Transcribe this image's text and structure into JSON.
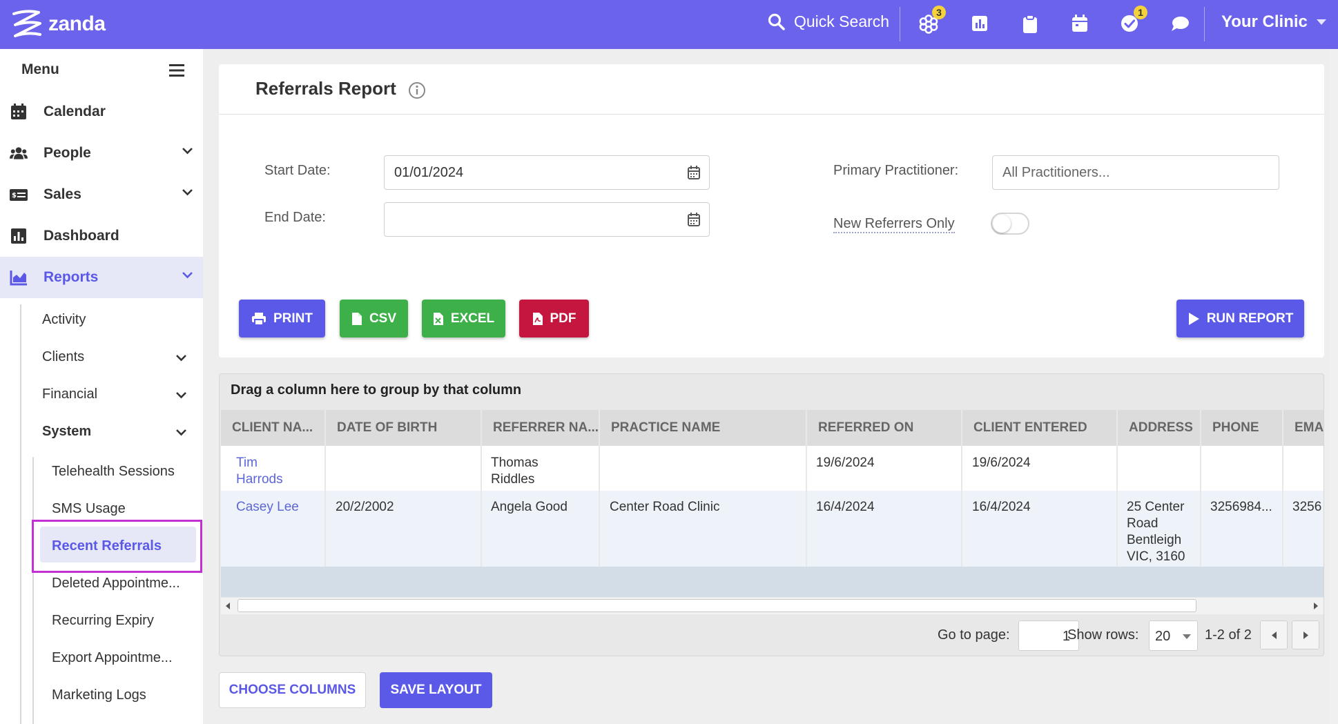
{
  "topbar": {
    "brand": "zanda",
    "quick_search": "Quick Search",
    "apps_badge": "3",
    "tasks_badge": "1",
    "clinic": "Your Clinic",
    "accent": "#6c63ec"
  },
  "sidebar": {
    "menu_label": "Menu",
    "items": [
      {
        "label": "Calendar",
        "icon": "calendar-icon"
      },
      {
        "label": "People",
        "icon": "people-icon"
      },
      {
        "label": "Sales",
        "icon": "sales-icon"
      },
      {
        "label": "Dashboard",
        "icon": "dashboard-icon"
      },
      {
        "label": "Reports",
        "icon": "reports-icon"
      }
    ],
    "reports_sub": [
      "Activity",
      "Clients",
      "Financial",
      "System"
    ],
    "system_sub": [
      "Telehealth Sessions",
      "SMS Usage",
      "Recent Referrals",
      "Deleted Appointme...",
      "Recurring Expiry",
      "Export Appointme...",
      "Marketing Logs"
    ]
  },
  "report": {
    "title": "Referrals Report",
    "start_date_label": "Start Date:",
    "start_date_value": "01/01/2024",
    "end_date_label": "End Date:",
    "end_date_value": "",
    "practitioner_label": "Primary Practitioner:",
    "practitioner_placeholder": "All Practitioners...",
    "new_referrers_label": "New Referrers Only",
    "new_referrers_on": false,
    "buttons": {
      "print": "PRINT",
      "csv": "CSV",
      "excel": "EXCEL",
      "pdf": "PDF",
      "run": "RUN REPORT"
    }
  },
  "grid": {
    "group_hint": "Drag a column here to group by that column",
    "columns": [
      "CLIENT NA...",
      "DATE OF BIRTH",
      "REFERRER NA...",
      "PRACTICE NAME",
      "REFERRED ON",
      "CLIENT ENTERED",
      "ADDRESS",
      "PHONE",
      "EMAI"
    ],
    "rows": [
      {
        "client": "Tim\nHarrods",
        "dob": "",
        "referrer": "Thomas\nRiddles",
        "practice": "",
        "referred_on": "19/6/2024",
        "client_entered": "19/6/2024",
        "address": "",
        "phone": "",
        "email": ""
      },
      {
        "client": "Casey Lee",
        "dob": "20/2/2002",
        "referrer": "Angela Good",
        "practice": "Center Road Clinic",
        "referred_on": "16/4/2024",
        "client_entered": "16/4/2024",
        "address": "25 Center\nRoad\nBentleigh\nVIC, 3160",
        "phone": "3256984...",
        "email": "3256"
      }
    ],
    "pager": {
      "goto_label": "Go to page:",
      "page": "1",
      "show_rows_label": "Show rows:",
      "rows": "20",
      "range": "1-2 of 2"
    }
  },
  "footer_buttons": {
    "choose_columns": "CHOOSE COLUMNS",
    "save_layout": "SAVE LAYOUT"
  }
}
